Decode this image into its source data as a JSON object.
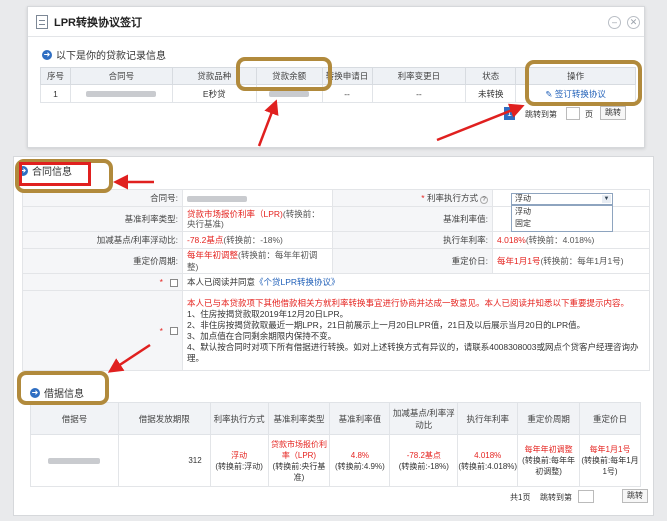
{
  "dialog": {
    "title": "LPR转换协议签订",
    "section": "以下是你的贷款记录信息",
    "columns": [
      "序号",
      "合同号",
      "贷款品种",
      "贷款余额",
      "转换申请日",
      "利率变更日",
      "状态",
      "操作"
    ],
    "row": {
      "index": "1",
      "product": "E秒贷",
      "apply_date": "--",
      "change_date": "--",
      "status": "未转换",
      "action": "签订转换协议"
    },
    "pager": {
      "page": "1",
      "go_to": "跳转到第",
      "page_unit": "页",
      "jump": "跳转"
    }
  },
  "contract": {
    "tab": "合同信息",
    "contract_no_label": "合同号:",
    "rate_method_label": "利率执行方式",
    "rate_method_value": "浮动",
    "rate_method_options": [
      "浮动",
      "固定"
    ],
    "base_type_label": "基准利率类型:",
    "base_type_value": "贷款市场报价利率（LPR)",
    "base_type_before": "(转换前：央行基准)",
    "base_value_label": "基准利率值:",
    "spread_label": "加减基点/利率浮动比:",
    "spread_value": "-78.2基点",
    "spread_before": "(转换前：-18%)",
    "annual_label": "执行年利率:",
    "annual_value": "4.018%",
    "annual_before": "(转换前：4.018%)",
    "reprice_period_label": "重定价周期:",
    "reprice_period_value": "每年年初调整",
    "reprice_period_before": "(转换前：每年年初调整)",
    "reprice_day_label": "重定价日:",
    "reprice_day_value": "每年1月1号",
    "reprice_day_before": "(转换前：每年1月1号)",
    "agree_text": "本人已阅读并同意",
    "agree_link": "《个贷LPR转换协议》",
    "notice_head": "本人已与本贷款项下其他借款相关方就利率转换事宜进行协商并达成一致意见。本人已阅读并知悉以下重要提示内容。",
    "notice_lines": [
      "1、住房按揭贷款取2019年12月20日LPR。",
      "2、非住房按揭贷款取最近一期LPR，21日前展示上一月20日LPR值，21日及以后展示当月20日的LPR值。",
      "3、加点值在合同剩余期限内保持不变。",
      "4、默认按合同时对项下所有借据进行转换。如对上述转换方式有异议的，请联系4008308003或网点个贷客户经理咨询办理。"
    ]
  },
  "receipt": {
    "tab": "借据信息",
    "columns": [
      "借据号",
      "借据发放期限",
      "利率执行方式",
      "基准利率类型",
      "基准利率值",
      "加减基点/利率浮动比",
      "执行年利率",
      "重定价周期",
      "重定价日"
    ],
    "row": {
      "term": "312",
      "method": "浮动",
      "method_before": "(转换前:浮动)",
      "base_type": "贷款市场报价利率（LPR)",
      "base_type_before": "(转换前:央行基准)",
      "base_value": "4.8%",
      "base_value_before": "(转换前:4.9%)",
      "spread": "-78.2基点",
      "spread_before": "(转换前:-18%)",
      "annual": "4.018%",
      "annual_before": "(转换前:4.018%)",
      "period": "每年年初调整",
      "period_before": "(转换前:每年年初调整)",
      "day": "每年1月1号",
      "day_before": "(转换前:每年1月1号)"
    },
    "pager": {
      "total": "共1页",
      "go_to": "跳转到第",
      "jump": "跳转"
    }
  },
  "colors": {
    "highlight": "#b18a3c",
    "red": "#e52420",
    "link": "#1f5fb8",
    "arrow": "#e0201f"
  }
}
